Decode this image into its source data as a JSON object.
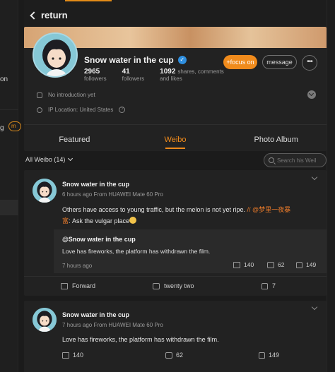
{
  "left_panel": {
    "text1": "on",
    "text2": "g",
    "tag": "m"
  },
  "header": {
    "back_label": "return"
  },
  "profile": {
    "name": "Snow water in the cup",
    "verified_icon": "verified-badge",
    "stats": [
      {
        "num": "2965",
        "label": "followers"
      },
      {
        "num": "41",
        "label": "followers"
      },
      {
        "num": "1092",
        "label_inline": "shares, comments",
        "label": "and likes"
      }
    ],
    "focus_label": "+focus on",
    "message_label": "message",
    "more_label": "•••",
    "intro": "No introduction yet",
    "ip": "IP Location: United States",
    "help_icon": "?",
    "tabs": [
      "Featured",
      "Weibo",
      "Photo Album"
    ],
    "active_tab": "Weibo"
  },
  "filter": {
    "label": "All Weibo (14)",
    "search_placeholder": "Search his Weil"
  },
  "posts": [
    {
      "author": "Snow water in the cup",
      "meta": "6 hours ago  From HUAWEI Mate 60 Pro",
      "text_a": "Others have access to young traffic, but the melon is not yet ripe. ",
      "text_link": "// @梦里一夜暴",
      "text_link2": "富",
      "text_b": ": Ask the vulgar place",
      "repost": {
        "author": "@Snow water in the cup",
        "text": "Love has fireworks, the platform has withdrawn the film.",
        "time": "7 hours ago",
        "shares": "140",
        "comments": "62",
        "likes": "149"
      },
      "actions": {
        "forward": "Forward",
        "comment": "twenty two",
        "like": "7"
      }
    },
    {
      "author": "Snow water in the cup",
      "meta": "7 hours ago  From HUAWEI Mate 60 Pro",
      "text": "Love has fireworks, the platform has withdrawn the film.",
      "shares": "140",
      "comments": "62",
      "likes": "149"
    }
  ],
  "colors": {
    "accent": "#f08b1c",
    "link": "#eb7b2a",
    "background": "#1b1b1b",
    "card": "#222222"
  }
}
